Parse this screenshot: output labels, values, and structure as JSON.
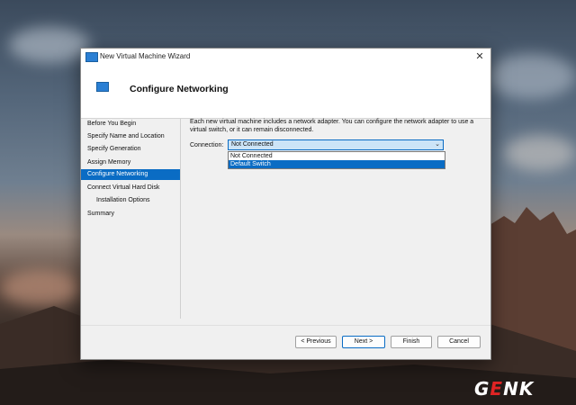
{
  "window": {
    "title": "New Virtual Machine Wizard",
    "close_glyph": "✕"
  },
  "header": {
    "title": "Configure Networking"
  },
  "nav": {
    "items": [
      {
        "label": "Before You Begin"
      },
      {
        "label": "Specify Name and Location"
      },
      {
        "label": "Specify Generation"
      },
      {
        "label": "Assign Memory"
      },
      {
        "label": "Configure Networking"
      },
      {
        "label": "Connect Virtual Hard Disk"
      },
      {
        "label": "Installation Options"
      },
      {
        "label": "Summary"
      }
    ]
  },
  "main": {
    "description": "Each new virtual machine includes a network adapter. You can configure the network adapter to use a virtual switch, or it can remain disconnected.",
    "connection_label": "Connection:",
    "connection_value": "Not Connected",
    "connection_options": [
      "Not Connected",
      "Default Switch"
    ],
    "chevron_glyph": "⌄"
  },
  "buttons": {
    "previous": "< Previous",
    "next": "Next >",
    "finish": "Finish",
    "cancel": "Cancel"
  },
  "watermark": {
    "text_g": "G",
    "text_e": "E",
    "text_nk": "NK"
  }
}
